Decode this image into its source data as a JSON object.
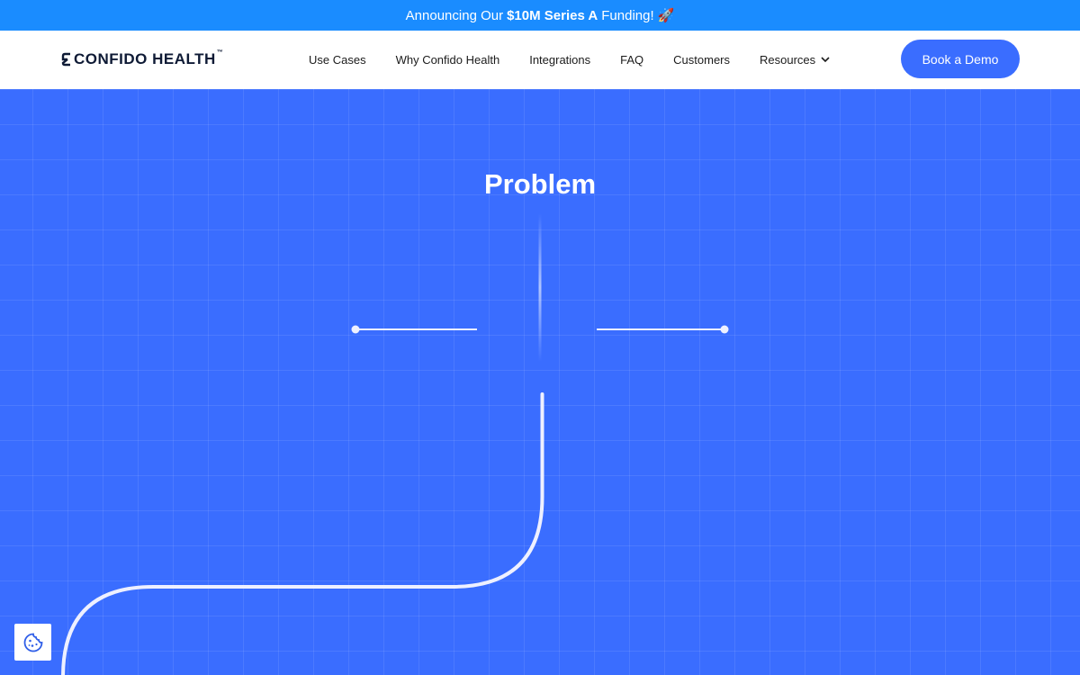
{
  "announcement": {
    "prefix": "Announcing Our",
    "highlight": "$10M Series A",
    "suffix": "Funding!",
    "emoji": "🚀"
  },
  "header": {
    "logo_text": "CONFIDO HEALTH",
    "logo_tm": "™",
    "nav": [
      {
        "label": "Use Cases"
      },
      {
        "label": "Why Confido Health"
      },
      {
        "label": "Integrations"
      },
      {
        "label": "FAQ"
      },
      {
        "label": "Customers"
      },
      {
        "label": "Resources",
        "icon": "chevron-down-icon"
      }
    ],
    "cta_label": "Book a Demo"
  },
  "hero": {
    "title": "Problem"
  },
  "cookie_icon": "cookie-icon",
  "colors": {
    "announcement_bg": "#1a8cff",
    "accent": "#3a6dff",
    "header_bg": "#ffffff",
    "text_dark": "#0e1a35"
  }
}
